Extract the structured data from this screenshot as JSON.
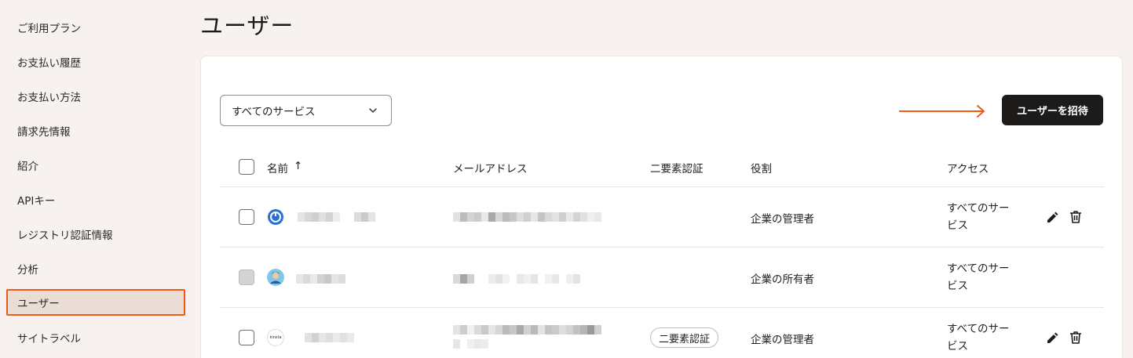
{
  "sidebar": {
    "items": [
      {
        "label": "ご利用プラン"
      },
      {
        "label": "お支払い履歴"
      },
      {
        "label": "お支払い方法"
      },
      {
        "label": "請求先情報"
      },
      {
        "label": "紹介"
      },
      {
        "label": "APIキー"
      },
      {
        "label": "レジストリ認証情報"
      },
      {
        "label": "分析"
      },
      {
        "label": "ユーザー",
        "active": true
      },
      {
        "label": "サイトラベル"
      }
    ]
  },
  "page": {
    "title": "ユーザー"
  },
  "filter": {
    "selected": "すべてのサービス"
  },
  "toolbar": {
    "invite_label": "ユーザーを招待"
  },
  "table": {
    "headers": {
      "name": "名前",
      "sort": "↑",
      "email": "メールアドレス",
      "twofa": "二要素認証",
      "role": "役割",
      "access": "アクセス"
    },
    "rows": [
      {
        "role": "企業の管理者",
        "access": "すべてのサービス",
        "twofa": ""
      },
      {
        "role": "企業の所有者",
        "access": "すべてのサービス",
        "twofa": ""
      },
      {
        "role": "企業の管理者",
        "access": "すべてのサービス",
        "twofa": "二要素認証",
        "avatar_text": "kinsta"
      }
    ]
  },
  "colors": {
    "accent": "#f05a16",
    "button": "#1d1a1a",
    "background": "#f7f2ef"
  }
}
